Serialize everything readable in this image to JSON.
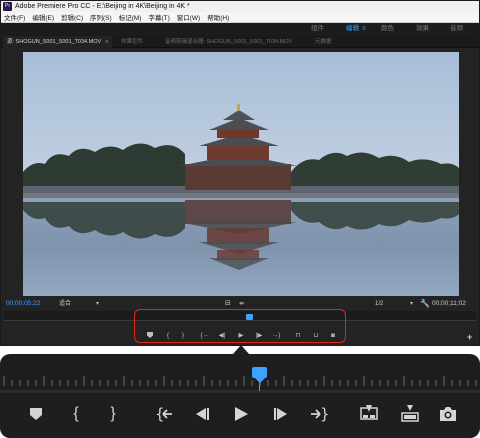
{
  "window": {
    "title": "Adobe Premiere Pro CC - E:\\Beijing in 4K\\Beijing in 4K *",
    "app_icon_label": "Pr"
  },
  "menu": [
    "文件(F)",
    "编辑(E)",
    "剪辑(C)",
    "序列(S)",
    "标记(M)",
    "字幕(T)",
    "窗口(W)",
    "帮助(H)"
  ],
  "workspaces": {
    "tabs": [
      "组件",
      "编辑",
      "颜色",
      "效果",
      "音频"
    ],
    "active": "编辑",
    "menu_glyph": "≡"
  },
  "panel_tabs": [
    {
      "label": "源: SHOGUN_S001_S001_T034.MOV",
      "close": "≡",
      "active": true
    },
    {
      "label": "效果控件",
      "active": false
    },
    {
      "label": "音频剪辑混合器: SHOGUN_S001_S001_T034.MOV",
      "active": false
    },
    {
      "label": "元数据",
      "active": false
    }
  ],
  "monitor": {
    "timecode_current": "00;00;05;22",
    "timecode_duration": "00;00;11;02",
    "fit_label": "适合",
    "resolution_label": "1/2",
    "playhead_fraction": 0.52
  },
  "controls": [
    {
      "name": "add-marker",
      "icon": "marker"
    },
    {
      "name": "mark-in",
      "icon": "brace-left"
    },
    {
      "name": "mark-out",
      "icon": "brace-right"
    },
    {
      "name": "go-to-in",
      "icon": "go-to-in"
    },
    {
      "name": "step-back",
      "icon": "step-back"
    },
    {
      "name": "play",
      "icon": "play"
    },
    {
      "name": "step-forward",
      "icon": "step-forward"
    },
    {
      "name": "go-to-out",
      "icon": "go-to-out"
    },
    {
      "name": "insert",
      "icon": "insert"
    },
    {
      "name": "overwrite",
      "icon": "overwrite"
    },
    {
      "name": "export-frame",
      "icon": "camera"
    }
  ],
  "colors": {
    "accent": "#3ea2ff",
    "panel_bg": "#232323",
    "highlight": "#e2231a"
  }
}
